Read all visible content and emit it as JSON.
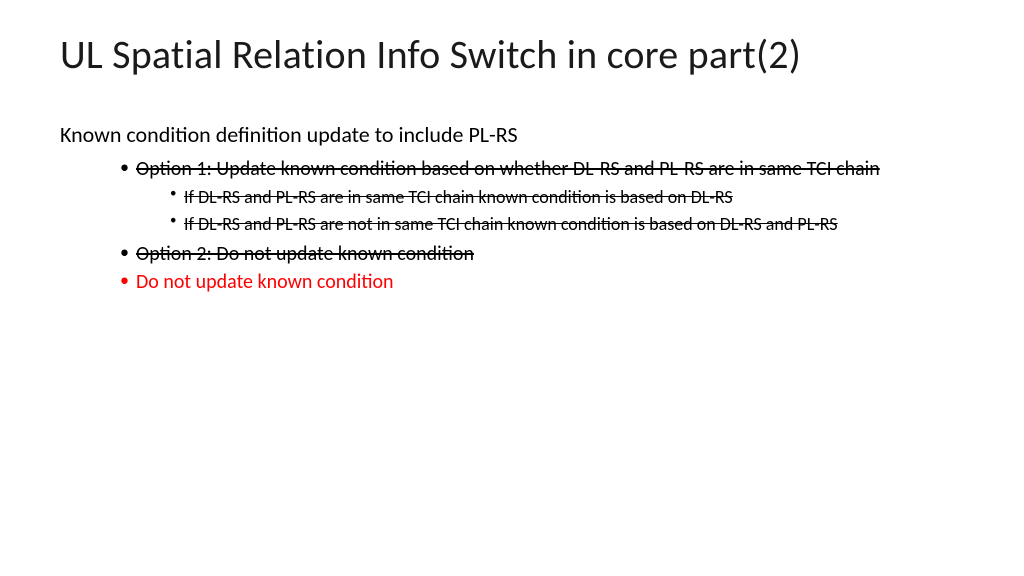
{
  "title": "UL Spatial Relation Info Switch in core part(2)",
  "intro": "Known condition definition update to include PL-RS",
  "bullets": {
    "option1": "Option 1: Update known condition based on whether DL-RS and PL-RS are in same TCI chain",
    "option1_sub1": "If DL-RS and PL-RS are in same TCI chain known condition is based on DL-RS",
    "option1_sub2": "If DL-RS and PL-RS are not in same TCI chain known condition is based on DL-RS and PL-RS",
    "option2": "Option 2: Do not update known condition",
    "conclusion": "Do not update known condition"
  }
}
